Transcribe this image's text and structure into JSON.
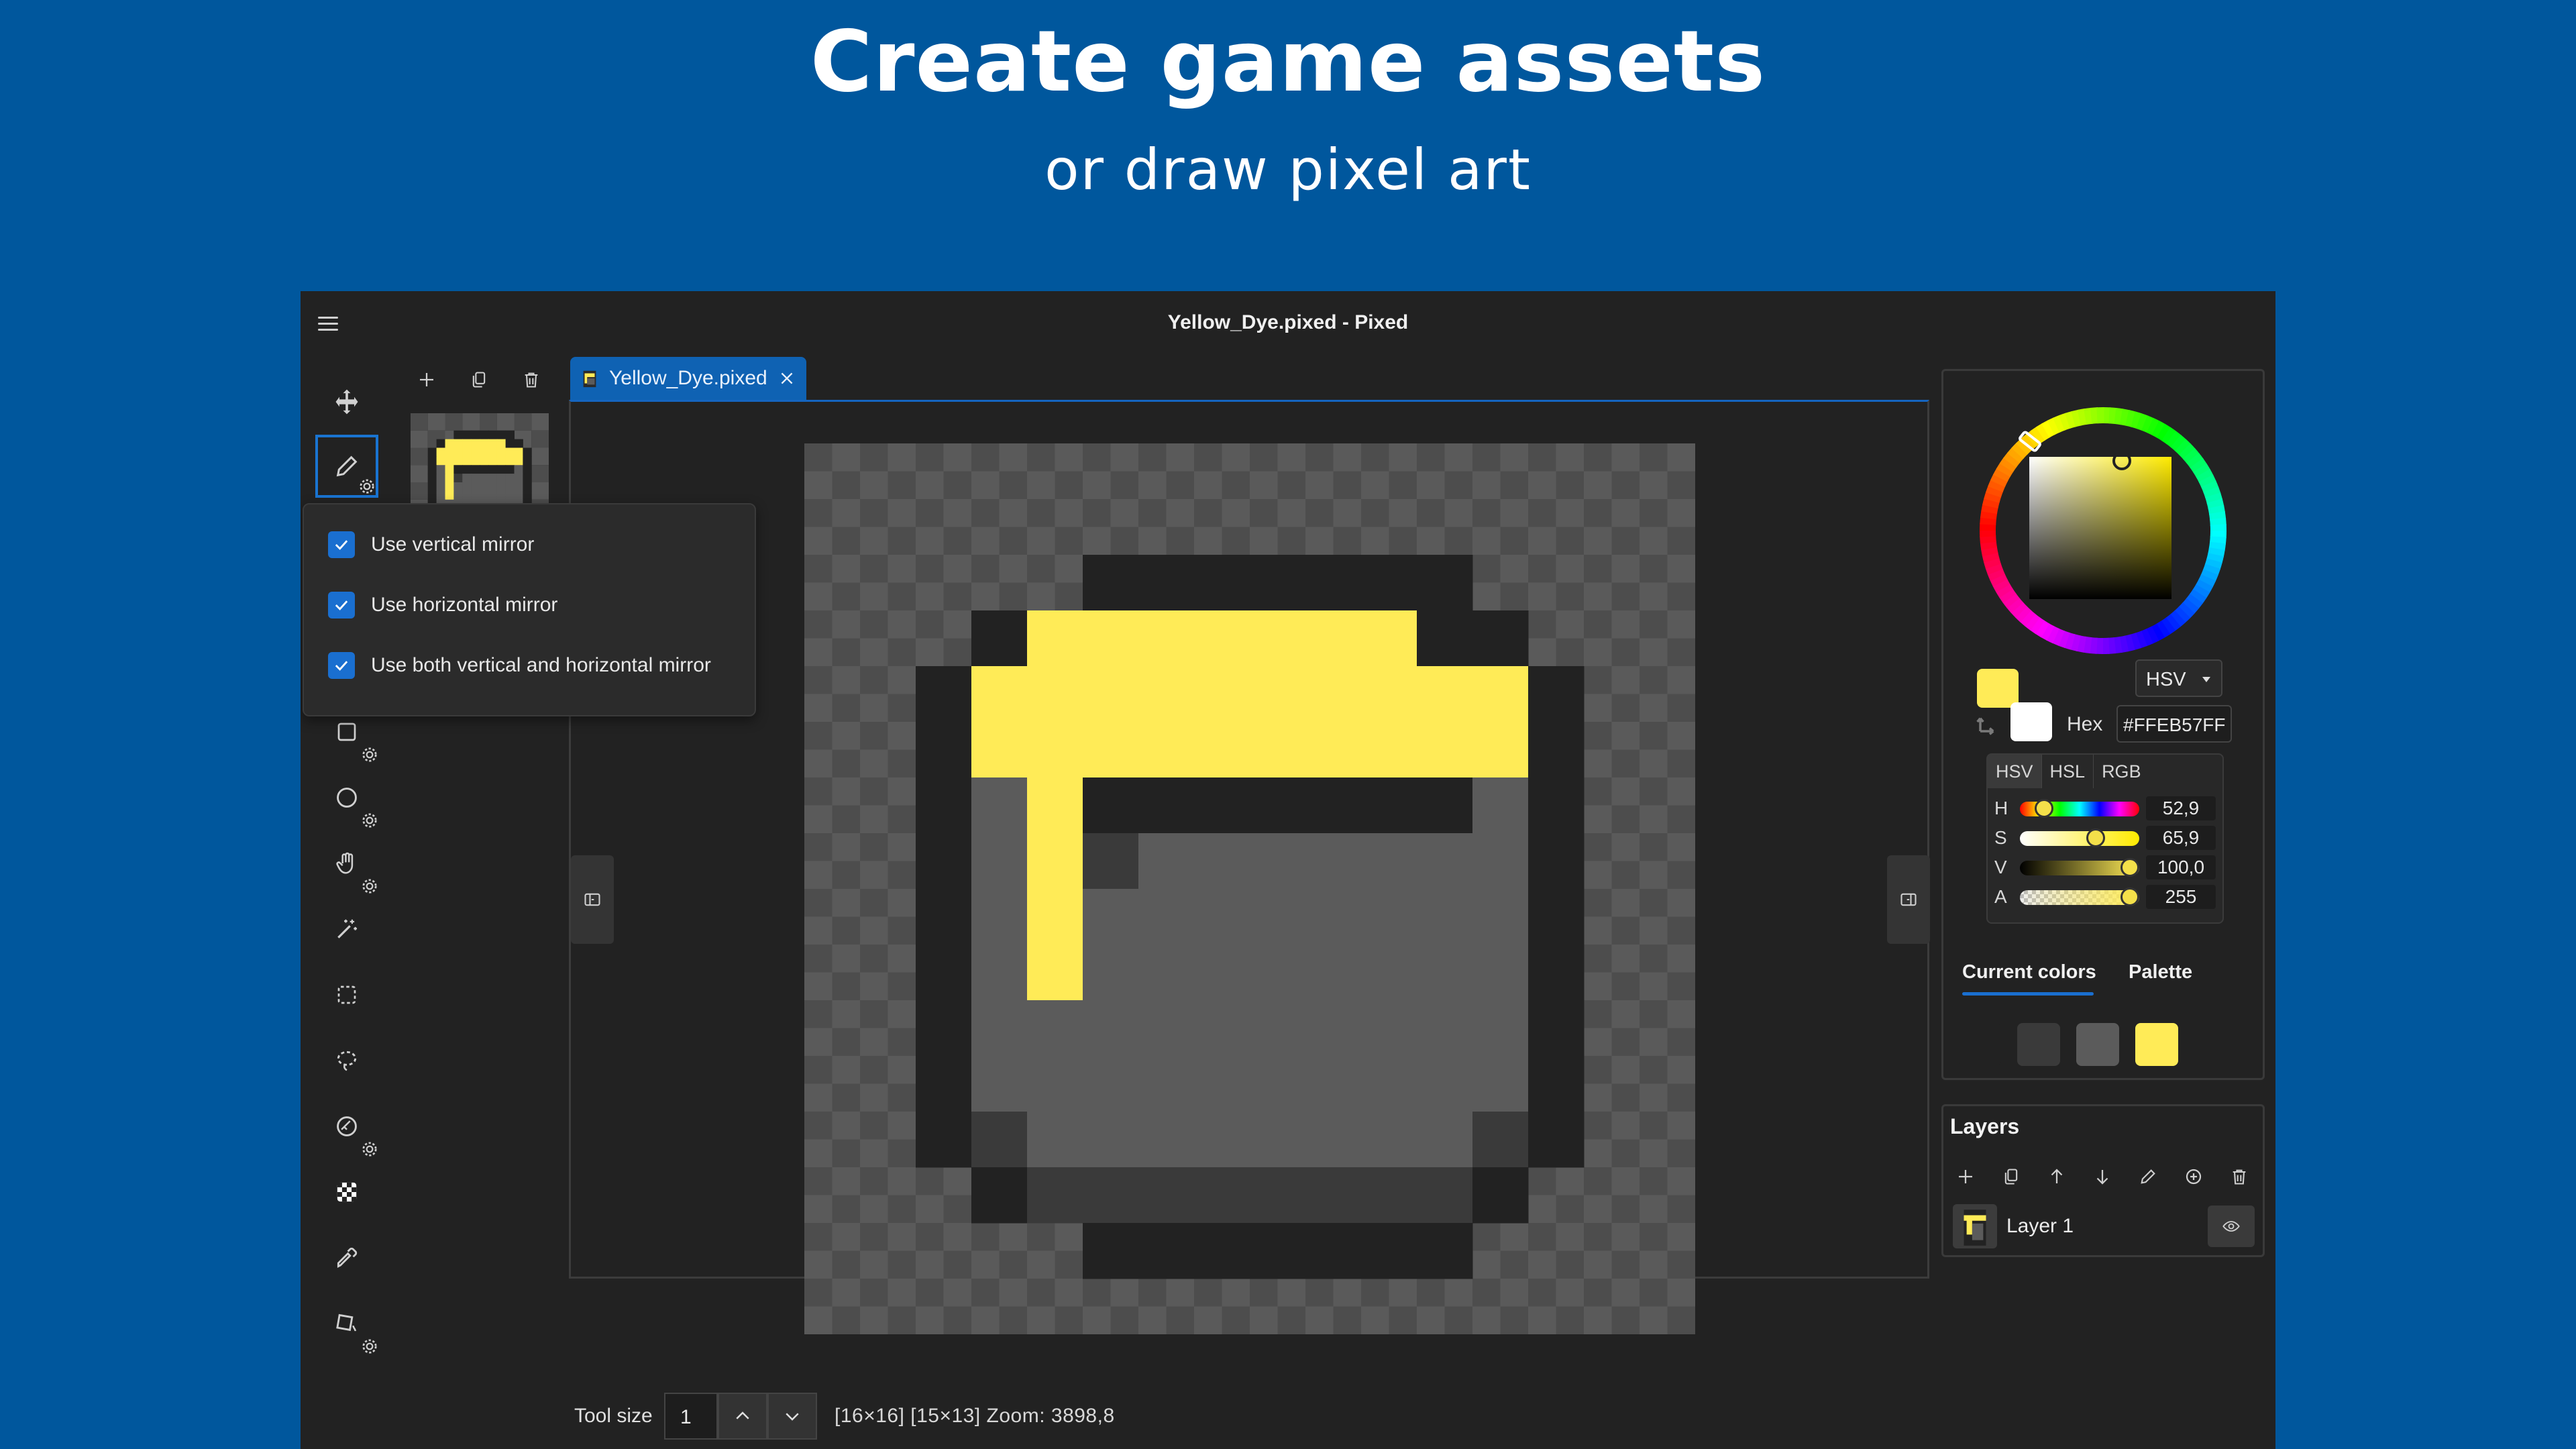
{
  "banner": {
    "title": "Create game assets",
    "subtitle": "or draw pixel art"
  },
  "window": {
    "title": "Yellow_Dye.pixed - Pixed"
  },
  "toolbar": {
    "tools": [
      "move-tool",
      "pencil-tool",
      "rectangle-tool",
      "ellipse-tool",
      "hand-tool",
      "magic-wand-tool",
      "rect-select-tool",
      "lasso-select-tool",
      "eraser-tool",
      "checker-tool",
      "eyedropper-tool",
      "fill-tool"
    ],
    "active": "pencil-tool"
  },
  "mirror_popup": {
    "options": [
      {
        "label": "Use vertical mirror",
        "checked": true
      },
      {
        "label": "Use horizontal mirror",
        "checked": true
      },
      {
        "label": "Use both vertical and horizontal mirror",
        "checked": true
      }
    ]
  },
  "document_tab": {
    "label": "Yellow_Dye.pixed"
  },
  "statusbar": {
    "tool_size_label": "Tool size",
    "tool_size_value": "1",
    "info": "[16×16]  [15×13]  Zoom: 3898,8"
  },
  "color_panel": {
    "primary_color": "#FFEB57",
    "secondary_color": "#FFFFFF",
    "mode": "HSV",
    "hex_label": "Hex",
    "hex_value": "#FFEB57FF",
    "model_tabs": [
      "HSV",
      "HSL",
      "RGB"
    ],
    "active_model": "HSV",
    "sliders": [
      {
        "label": "H",
        "value": "52,9",
        "fraction": 0.147
      },
      {
        "label": "S",
        "value": "65,9",
        "fraction": 0.659
      },
      {
        "label": "V",
        "value": "100,0",
        "fraction": 1.0
      },
      {
        "label": "A",
        "value": "255",
        "fraction": 1.0
      }
    ],
    "tabs": {
      "current": "Current colors",
      "palette": "Palette"
    },
    "current_colors": [
      "#222222",
      "#3a3a3a",
      "#5b5b5b",
      "#FFEB57"
    ]
  },
  "layers": {
    "title": "Layers",
    "items": [
      {
        "name": "Layer 1",
        "visible": true
      }
    ]
  },
  "sprite": {
    "width": 16,
    "height": 16,
    "palette": {
      "0": "transparent",
      "1": "#222222",
      "2": "#3a3a3a",
      "3": "#5b5b5b",
      "4": "#FFEB57"
    },
    "rows": [
      "0000000000000000",
      "0000000000000000",
      "0000011111110000",
      "0001444444411000",
      "0014444444444100",
      "0014444444444100",
      "0013411111113100",
      "0013423333333100",
      "0013433333333100",
      "0013433333333100",
      "0013333333333100",
      "0013333333333100",
      "0012333333332100",
      "0001222222221000",
      "0000011111110000",
      "0000000000000000"
    ]
  }
}
